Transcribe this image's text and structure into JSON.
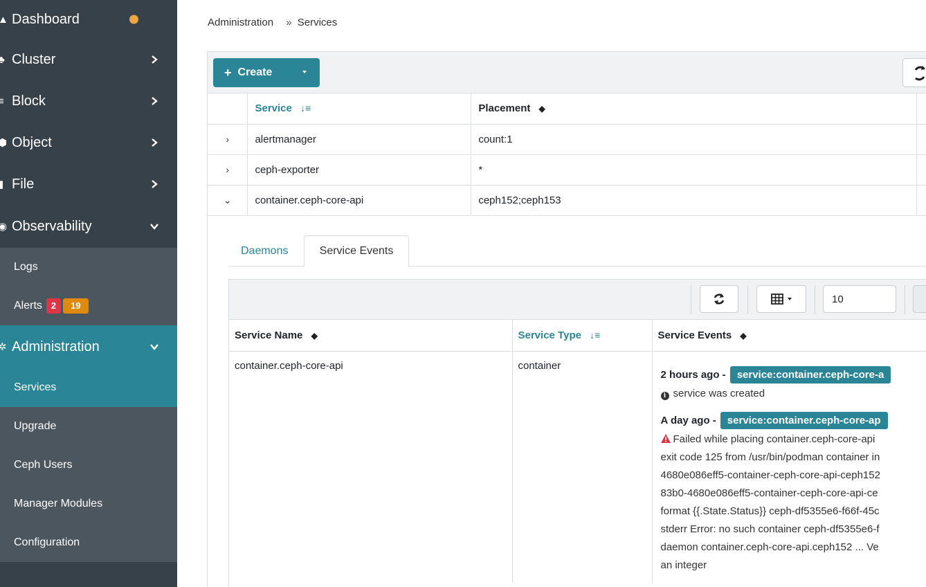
{
  "sidebar": {
    "dashboard": "Dashboard",
    "cluster": "Cluster",
    "block": "Block",
    "object": "Object",
    "file": "File",
    "observability": "Observability",
    "logs": "Logs",
    "alerts": "Alerts",
    "alerts_red": "2",
    "alerts_orange": "19",
    "administration": "Administration",
    "services": "Services",
    "upgrade": "Upgrade",
    "ceph_users": "Ceph Users",
    "manager_modules": "Manager Modules",
    "configuration": "Configuration"
  },
  "breadcrumb": {
    "parent": "Administration",
    "sep": "»",
    "current": "Services"
  },
  "toolbar": {
    "create_label": "Create"
  },
  "services_table": {
    "headers": {
      "service": "Service",
      "placement": "Placement"
    },
    "rows": [
      {
        "expander": "›",
        "service": "alertmanager",
        "placement": "count:1"
      },
      {
        "expander": "›",
        "service": "ceph-exporter",
        "placement": "*"
      },
      {
        "expander": "⌄",
        "service": "container.ceph-core-api",
        "placement": "ceph152;ceph153"
      }
    ]
  },
  "detail_tabs": {
    "daemons": "Daemons",
    "service_events": "Service Events"
  },
  "events_toolbar": {
    "page_size": "10"
  },
  "events_table": {
    "headers": {
      "service_name": "Service Name",
      "service_type": "Service Type",
      "service_events": "Service Events"
    },
    "row": {
      "service_name": "container.ceph-core-api",
      "service_type": "container",
      "events": [
        {
          "when": "2 hours ago -",
          "tag": "service:container.ceph-core-a",
          "lines": [
            "service was created"
          ]
        },
        {
          "when": "A day ago -",
          "tag": "service:container.ceph-core-ap",
          "lines": [
            "Failed while placing container.ceph-core-api",
            "exit code 125 from /usr/bin/podman container in",
            "4680e086eff5-container-ceph-core-api-ceph152",
            "83b0-4680e086eff5-container-ceph-core-api-ce",
            "format {{.State.Status}} ceph-df5355e6-f66f-45c",
            "stderr Error: no such container ceph-df5355e6-f",
            "daemon container.ceph-core-api.ceph152 ... Ve",
            "an integer"
          ]
        }
      ]
    }
  },
  "colors": {
    "accent": "#2a8596",
    "sidebar_bg": "#374149",
    "sub_bg": "#4b565f",
    "danger": "#dc3545",
    "warning": "#e08a0b"
  }
}
